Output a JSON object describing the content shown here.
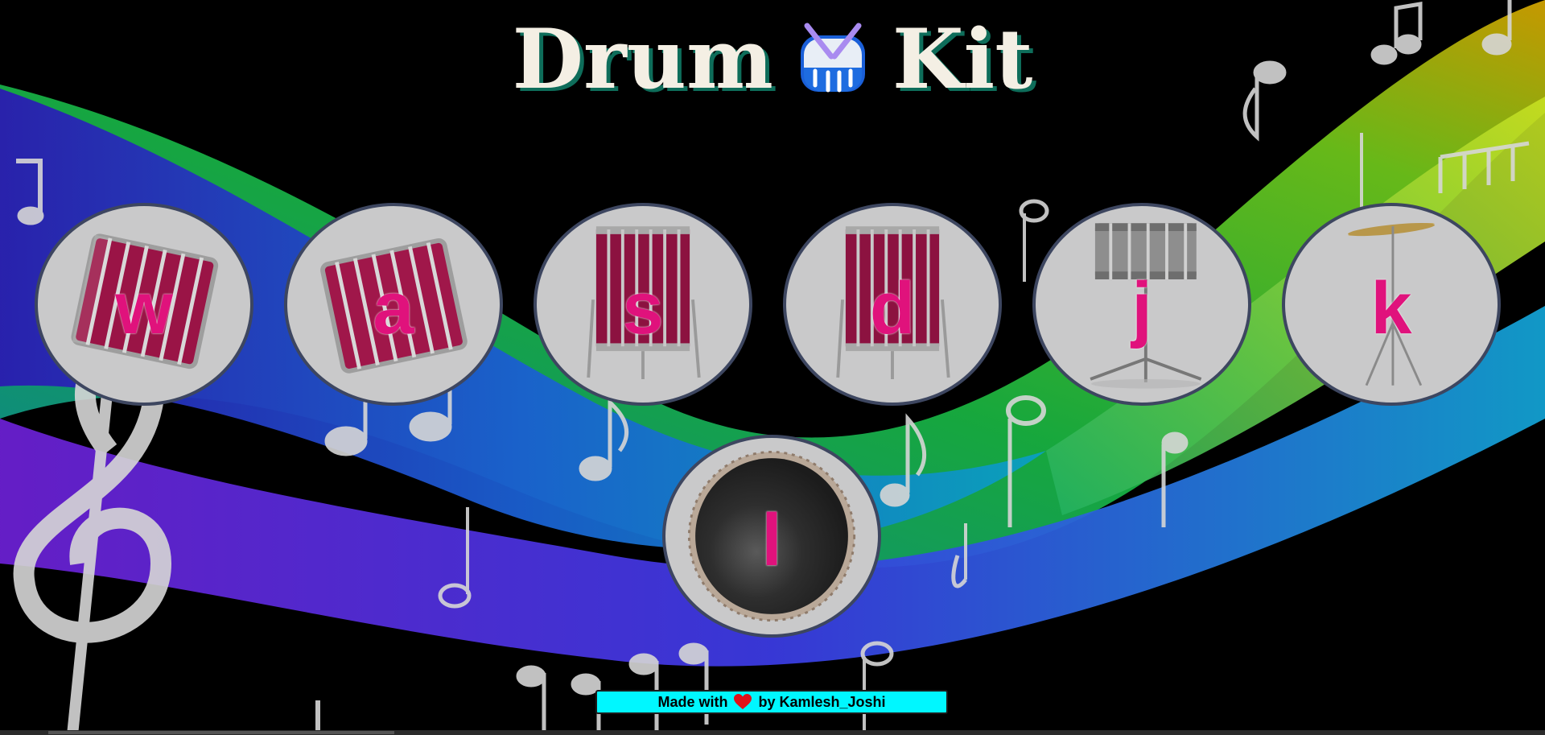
{
  "page": {
    "title_part1": "Drum",
    "title_part2": "Kit",
    "title_icon": "drum-emoji-icon"
  },
  "drums": [
    {
      "key": "w",
      "instrument": "tom-drum-tilted",
      "art": "tom"
    },
    {
      "key": "a",
      "instrument": "tom-drum-tilted",
      "art": "tom"
    },
    {
      "key": "s",
      "instrument": "floor-tom",
      "art": "floor"
    },
    {
      "key": "d",
      "instrument": "floor-tom",
      "art": "floor"
    },
    {
      "key": "j",
      "instrument": "snare-drum",
      "art": "snare"
    },
    {
      "key": "k",
      "instrument": "crash-cymbal",
      "art": "cymbal"
    },
    {
      "key": "l",
      "instrument": "kick-drum",
      "art": "kick"
    }
  ],
  "footer": {
    "text_before": "Made with",
    "heart_icon": "heart-icon",
    "text_after": "by Kamlesh_Joshi"
  },
  "colors": {
    "key_letter": "#e0127c",
    "drum_face": "#c9c9ca",
    "drum_border": "#3d4660",
    "footer_bg": "#00f7ff",
    "title_text": "#f4efe4",
    "title_shadow": "#0e6d5a"
  }
}
